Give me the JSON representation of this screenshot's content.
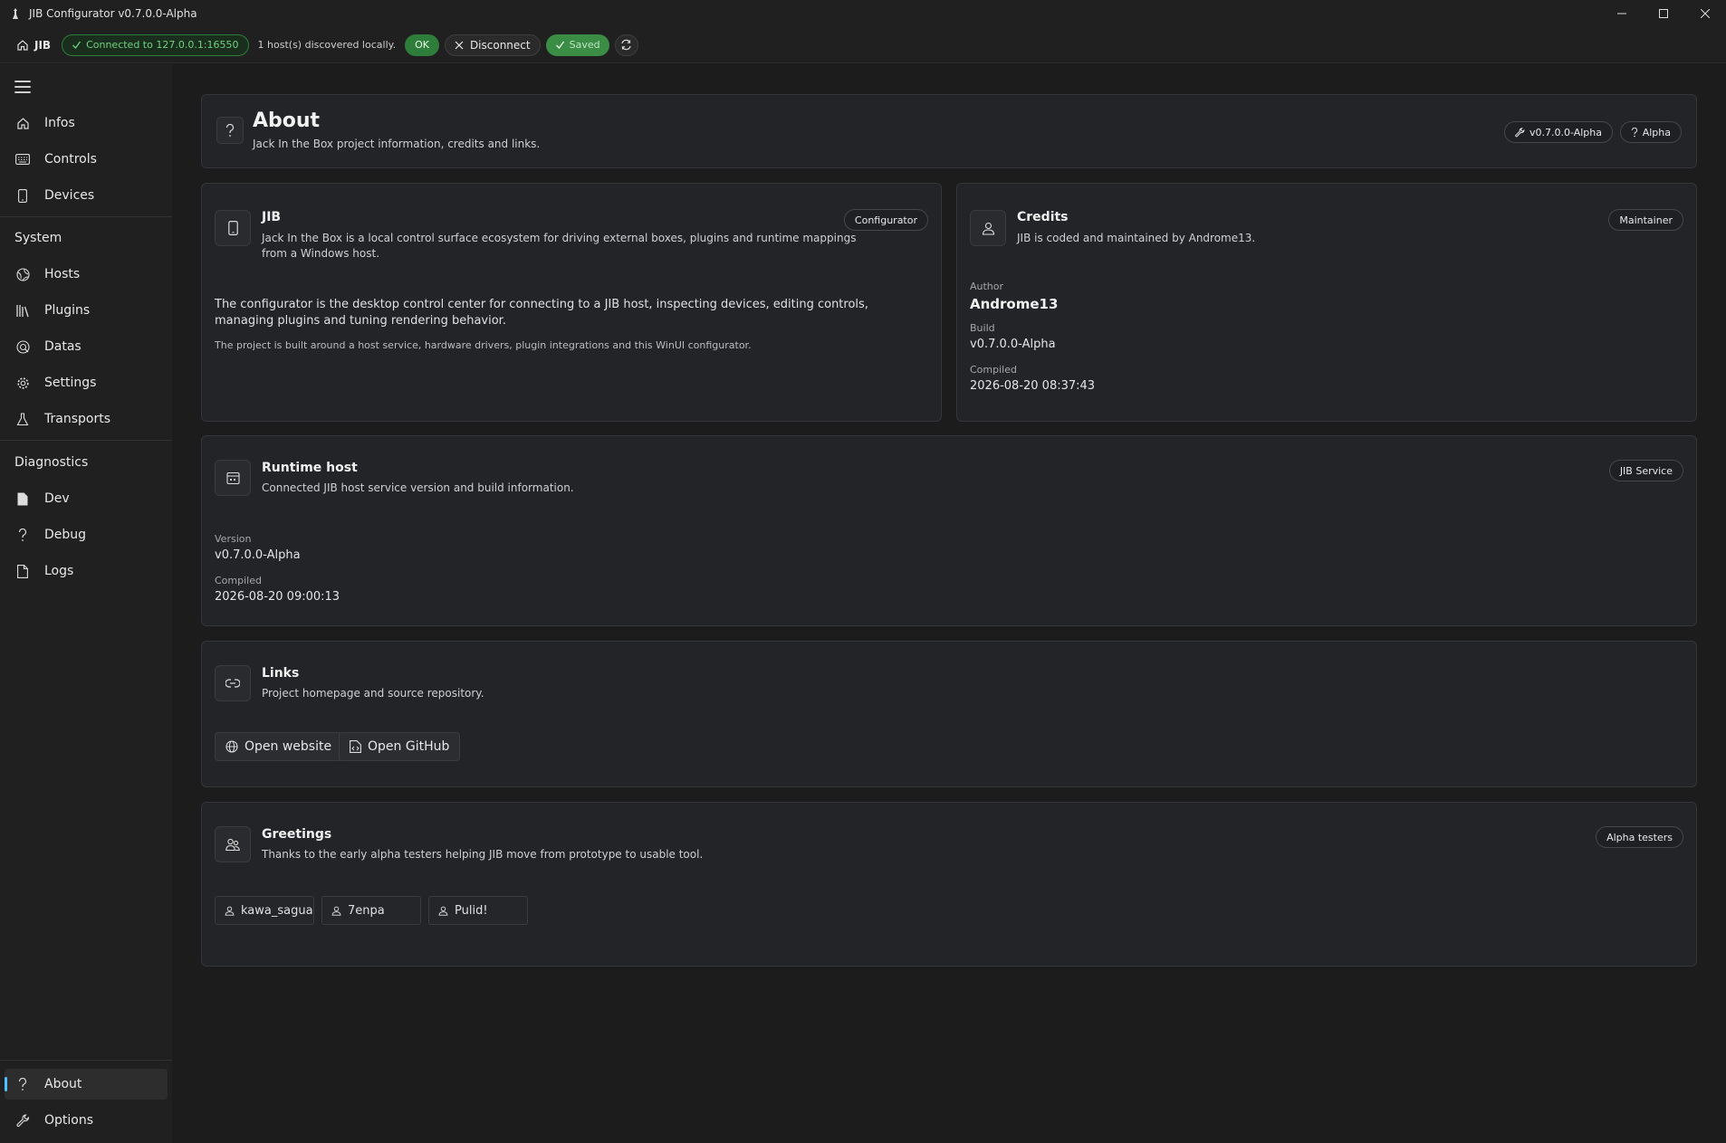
{
  "window": {
    "title": "JIB Configurator v0.7.0.0-Alpha"
  },
  "status": {
    "home_label": "JIB",
    "connection": "Connected to 127.0.0.1:16550",
    "hosts_discovered": "1 host(s) discovered locally.",
    "ok_label": "OK",
    "disconnect_label": "Disconnect",
    "saved_label": "Saved"
  },
  "sidebar": {
    "items_top": [
      {
        "label": "Infos",
        "icon": "home-icon"
      },
      {
        "label": "Controls",
        "icon": "keyboard-icon"
      },
      {
        "label": "Devices",
        "icon": "device-icon"
      }
    ],
    "section_system": "System",
    "items_system": [
      {
        "label": "Hosts",
        "icon": "globe-icon"
      },
      {
        "label": "Plugins",
        "icon": "library-icon"
      },
      {
        "label": "Datas",
        "icon": "data-icon"
      },
      {
        "label": "Settings",
        "icon": "gear-icon"
      },
      {
        "label": "Transports",
        "icon": "flask-icon"
      }
    ],
    "section_diagnostics": "Diagnostics",
    "items_diagnostics": [
      {
        "label": "Dev",
        "icon": "file-icon"
      },
      {
        "label": "Debug",
        "icon": "question-icon"
      },
      {
        "label": "Logs",
        "icon": "document-icon"
      }
    ],
    "items_bottom": [
      {
        "label": "About",
        "icon": "question-icon",
        "active": true
      },
      {
        "label": "Options",
        "icon": "wrench-icon"
      }
    ]
  },
  "about": {
    "title": "About",
    "subtitle": "Jack In the Box project information, credits and links.",
    "version_chip": "v0.7.0.0-Alpha",
    "stage_chip": "Alpha"
  },
  "jib_card": {
    "title": "JIB",
    "description": "Jack In the Box is a local control surface ecosystem for driving external boxes, plugins and runtime mappings from a Windows host.",
    "chip": "Configurator",
    "body": "The configurator is the desktop control center for connecting to a JIB host, inspecting devices, editing controls, managing plugins and tuning rendering behavior.",
    "note": "The project is built around a host service, hardware drivers, plugin integrations and this WinUI configurator."
  },
  "credits_card": {
    "title": "Credits",
    "subtitle": "JIB is coded and maintained by Androme13.",
    "chip": "Maintainer",
    "author_label": "Author",
    "author_value": "Androme13",
    "build_label": "Build",
    "build_value": "v0.7.0.0-Alpha",
    "compiled_label": "Compiled",
    "compiled_value": "2026-08-20 08:37:43"
  },
  "runtime_card": {
    "title": "Runtime host",
    "subtitle": "Connected JIB host service version and build information.",
    "chip": "JIB Service",
    "version_label": "Version",
    "version_value": "v0.7.0.0-Alpha",
    "compiled_label": "Compiled",
    "compiled_value": "2026-08-20 09:00:13"
  },
  "links_card": {
    "title": "Links",
    "subtitle": "Project homepage and source repository.",
    "website_label": "Open website",
    "github_label": "Open GitHub"
  },
  "greetings_card": {
    "title": "Greetings",
    "subtitle": "Thanks to the early alpha testers helping JIB move from prototype to usable tool.",
    "chip": "Alpha testers",
    "testers": [
      "kawa_sagua",
      "7enpa",
      "Pulid!"
    ]
  },
  "colors": {
    "accent": "#4cc2ff",
    "success": "#2f7d3b",
    "card_bg": "#232428"
  }
}
